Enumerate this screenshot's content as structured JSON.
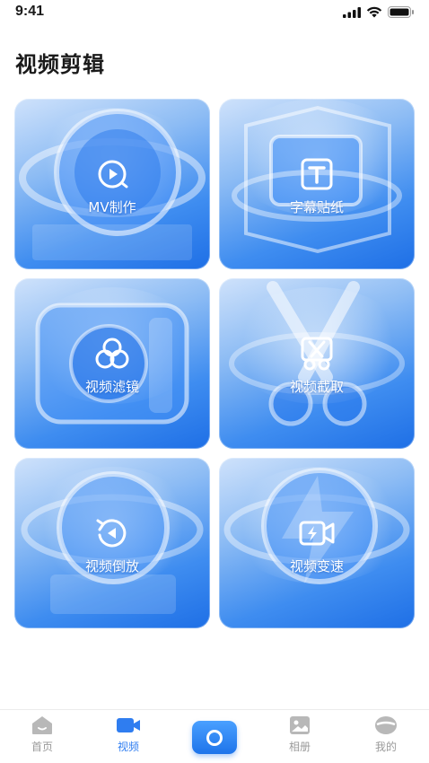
{
  "status": {
    "time": "9:41"
  },
  "page": {
    "title": "视频剪辑"
  },
  "cards": [
    {
      "label": "MV制作",
      "icon": "play-circle-icon"
    },
    {
      "label": "字幕贴纸",
      "icon": "text-box-icon"
    },
    {
      "label": "视频滤镜",
      "icon": "filter-circles-icon"
    },
    {
      "label": "视频截取",
      "icon": "scissors-icon"
    },
    {
      "label": "视频倒放",
      "icon": "rewind-icon"
    },
    {
      "label": "视频变速",
      "icon": "speed-camera-icon"
    }
  ],
  "tabs": [
    {
      "label": "首页",
      "icon": "home-icon",
      "active": false
    },
    {
      "label": "视频",
      "icon": "video-camera-icon",
      "active": true
    },
    {
      "label": "",
      "icon": "camera-icon",
      "active": false
    },
    {
      "label": "相册",
      "icon": "album-icon",
      "active": false
    },
    {
      "label": "我的",
      "icon": "profile-icon",
      "active": false
    }
  ],
  "colors": {
    "accent": "#2f7df0",
    "card_dark": "#1e6fe6",
    "card_light": "#cfe2fb",
    "tab_inactive": "#9a9a9a"
  }
}
